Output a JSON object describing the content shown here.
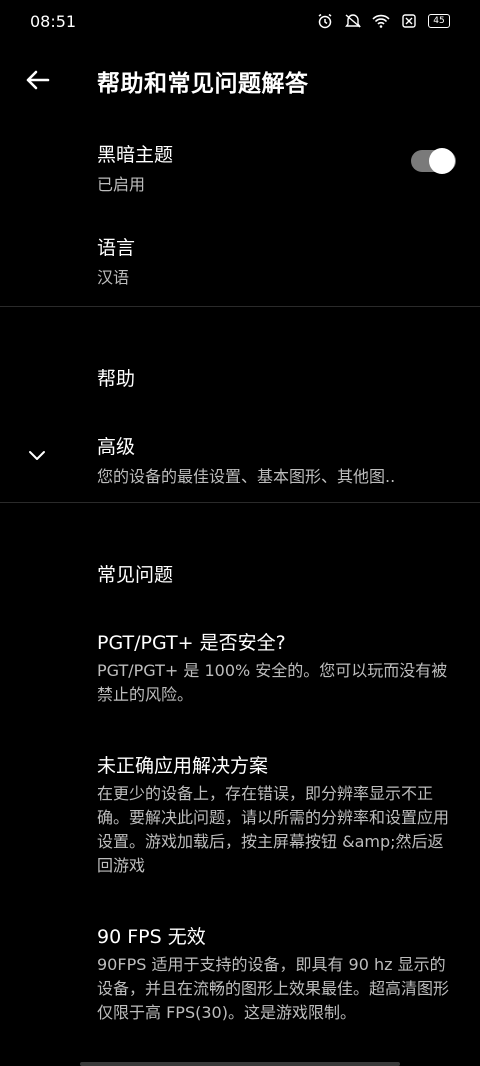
{
  "status": {
    "time": "08:51",
    "battery": "45"
  },
  "header": {
    "title": "帮助和常见问题解答"
  },
  "settings": {
    "dark_theme": {
      "title": "黑暗主题",
      "value": "已启用",
      "enabled": true
    },
    "language": {
      "title": "语言",
      "value": "汉语"
    },
    "help": {
      "title": "帮助"
    },
    "advanced": {
      "title": "高级",
      "subtitle": "您的设备的最佳设置、基本图形、其他图.."
    }
  },
  "faq": {
    "heading": "常见问题",
    "items": [
      {
        "q": "PGT/PGT+ 是否安全?",
        "a": "PGT/PGT+ 是 100% 安全的。您可以玩而没有被禁止的风险。"
      },
      {
        "q": "未正确应用解决方案",
        "a": "在更少的设备上，存在错误，即分辨率显示不正确。要解决此问题，请以所需的分辨率和设置应用设置。游戏加载后，按主屏幕按钮 &amp;然后返回游戏"
      },
      {
        "q": "90 FPS 无效",
        "a": "90FPS 适用于支持的设备，即具有 90 hz 显示的设备，并且在流畅的图形上效果最佳。超高清图形仅限于高 FPS(30)。这是游戏限制。"
      }
    ]
  }
}
